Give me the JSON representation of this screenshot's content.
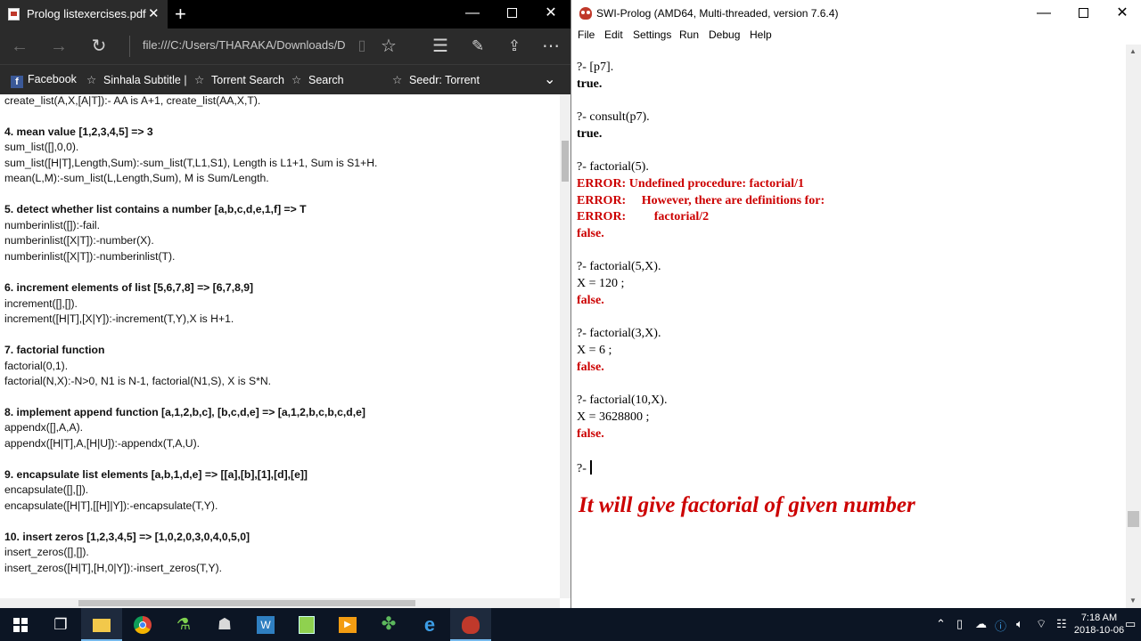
{
  "edge": {
    "tab_title": "Prolog listexercises.pdf",
    "new_tab": "+",
    "address": "file:///C:/Users/THARAKA/Downloads/Dc",
    "favorites": [
      {
        "label": "Facebook",
        "icon": "facebook-icon"
      },
      {
        "label": "Sinhala Subtitle |",
        "icon": "star-icon"
      },
      {
        "label": "Torrent Search",
        "icon": "star-icon"
      },
      {
        "label": "Search",
        "icon": "star-icon"
      },
      {
        "label": "Seedr: Torrent",
        "icon": "star-icon"
      }
    ],
    "pdf_lines": [
      {
        "text": "create_list(A,X,[A|T]):- AA is A+1, create_list(AA,X,T).",
        "bold": false
      },
      {
        "text": "4. mean value [1,2,3,4,5] => 3",
        "bold": true
      },
      {
        "text": "sum_list([],0,0).",
        "bold": false
      },
      {
        "text": "sum_list([H|T],Length,Sum):-sum_list(T,L1,S1), Length is L1+1, Sum is S1+H.",
        "bold": false
      },
      {
        "text": "mean(L,M):-sum_list(L,Length,Sum), M is Sum/Length.",
        "bold": false
      },
      {
        "text": "5. detect whether list contains a number [a,b,c,d,e,1,f] => T",
        "bold": true
      },
      {
        "text": "numberinlist([]):-fail.",
        "bold": false
      },
      {
        "text": "numberinlist([X|T]):-number(X).",
        "bold": false
      },
      {
        "text": "numberinlist([X|T]):-numberinlist(T).",
        "bold": false
      },
      {
        "text": "6. increment elements of list [5,6,7,8] => [6,7,8,9]",
        "bold": true
      },
      {
        "text": "increment([],[]).",
        "bold": false
      },
      {
        "text": "increment([H|T],[X|Y]):-increment(T,Y),X is H+1.",
        "bold": false
      },
      {
        "text": "7. factorial function",
        "bold": true
      },
      {
        "text": "factorial(0,1).",
        "bold": false
      },
      {
        "text": "factorial(N,X):-N>0, N1 is N-1, factorial(N1,S), X is S*N.",
        "bold": false
      },
      {
        "text": "8. implement append function [a,1,2,b,c], [b,c,d,e] => [a,1,2,b,c,b,c,d,e]",
        "bold": true
      },
      {
        "text": "appendx([],A,A).",
        "bold": false
      },
      {
        "text": "appendx([H|T],A,[H|U]):-appendx(T,A,U).",
        "bold": false
      },
      {
        "text": "9. encapsulate list elements [a,b,1,d,e] => [[a],[b],[1],[d],[e]]",
        "bold": true
      },
      {
        "text": "encapsulate([],[]).",
        "bold": false
      },
      {
        "text": "encapsulate([H|T],[[H]|Y]):-encapsulate(T,Y).",
        "bold": false
      },
      {
        "text": "10. insert zeros [1,2,3,4,5] => [1,0,2,0,3,0,4,0,5,0]",
        "bold": true
      },
      {
        "text": "insert_zeros([],[]).",
        "bold": false
      },
      {
        "text": "insert_zeros([H|T],[H,0|Y]):-insert_zeros(T,Y).",
        "bold": false
      }
    ]
  },
  "swi": {
    "title": "SWI-Prolog (AMD64, Multi-threaded, version 7.6.4)",
    "menu": [
      "File",
      "Edit",
      "Settings",
      "Run",
      "Debug",
      "Help"
    ],
    "console_lines": [
      {
        "text": "?- [p7].",
        "style": "normal"
      },
      {
        "text": "true.",
        "style": "b"
      },
      {
        "text": "?- consult(p7).",
        "style": "normal"
      },
      {
        "text": "true.",
        "style": "b"
      },
      {
        "text": "?- factorial(5).",
        "style": "normal"
      },
      {
        "text": "ERROR: Undefined procedure: factorial/1",
        "style": "red"
      },
      {
        "text": "ERROR:     However, there are definitions for:",
        "style": "red"
      },
      {
        "text": "ERROR:         factorial/2",
        "style": "red"
      },
      {
        "text": "false.",
        "style": "red"
      },
      {
        "text": "?- factorial(5,X).",
        "style": "normal"
      },
      {
        "text": "X = 120 ;",
        "style": "normal"
      },
      {
        "text": "false.",
        "style": "red"
      },
      {
        "text": "?- factorial(3,X).",
        "style": "normal"
      },
      {
        "text": "X = 6 ;",
        "style": "normal"
      },
      {
        "text": "false.",
        "style": "red"
      },
      {
        "text": "?- factorial(10,X).",
        "style": "normal"
      },
      {
        "text": "X = 3628800 ;",
        "style": "normal"
      },
      {
        "text": "false.",
        "style": "red"
      },
      {
        "text": "?-",
        "style": "normal"
      }
    ],
    "annotation": "It will give factorial of given number"
  },
  "taskbar": {
    "apps": [
      "start",
      "task-view",
      "file-explorer",
      "chrome",
      "app-green",
      "app-robot",
      "app-blue",
      "app-notepad",
      "app-media",
      "app-clover",
      "edge",
      "swi-prolog"
    ],
    "time": "7:18 AM",
    "date": "2018-10-06"
  },
  "colors": {
    "error_red": "#cc0000",
    "edge_chrome": "#2b2b2b",
    "taskbar": "#0c1524"
  }
}
